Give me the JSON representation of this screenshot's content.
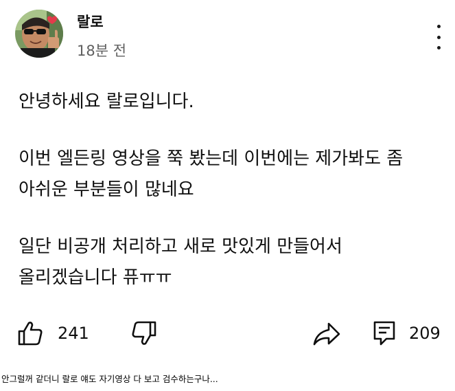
{
  "post": {
    "author": "랄로",
    "timestamp": "18분 전",
    "avatar_icon": "profile-photo-thumbs-up-heart",
    "more_icon": "more-vert-icon",
    "lines": [
      "안녕하세요 랄로입니다.",
      "이번 엘든링 영상을 쭉 봤는데 이번에는 제가봐도 좀",
      "아쉬운 부분들이 많네요",
      "일단 비공개 처리하고 새로 맛있게 만들어서",
      "올리겠습니다 퓨ㅠㅠ"
    ],
    "actions": {
      "like_icon": "thumbs-up-icon",
      "like_count": "241",
      "dislike_icon": "thumbs-down-icon",
      "share_icon": "share-icon",
      "comment_icon": "comment-icon",
      "comment_count": "209"
    }
  },
  "caption": "안그럴꺼 같더니 랄로 얘도 자기영상 다 보고 검수하는구나..."
}
